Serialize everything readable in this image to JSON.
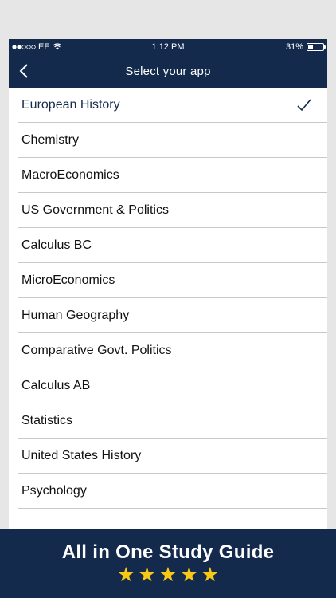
{
  "status_bar": {
    "carrier": "EE",
    "time": "1:12 PM",
    "battery_percent": "31%",
    "battery_level": 0.31
  },
  "nav": {
    "title": "Select your app",
    "back_icon": "chevron-left-icon"
  },
  "apps": [
    {
      "label": "European History",
      "selected": true
    },
    {
      "label": "Chemistry",
      "selected": false
    },
    {
      "label": "MacroEconomics",
      "selected": false
    },
    {
      "label": "US Government & Politics",
      "selected": false
    },
    {
      "label": "Calculus BC",
      "selected": false
    },
    {
      "label": "MicroEconomics",
      "selected": false
    },
    {
      "label": "Human Geography",
      "selected": false
    },
    {
      "label": "Comparative Govt. Politics",
      "selected": false
    },
    {
      "label": "Calculus AB",
      "selected": false
    },
    {
      "label": "Statistics",
      "selected": false
    },
    {
      "label": "United States History",
      "selected": false
    },
    {
      "label": "Psychology",
      "selected": false
    }
  ],
  "banner": {
    "title": "All in One Study Guide",
    "rating": 5
  },
  "colors": {
    "primary": "#132a4c",
    "star": "#f7c817",
    "background": "#e6e6e6"
  }
}
